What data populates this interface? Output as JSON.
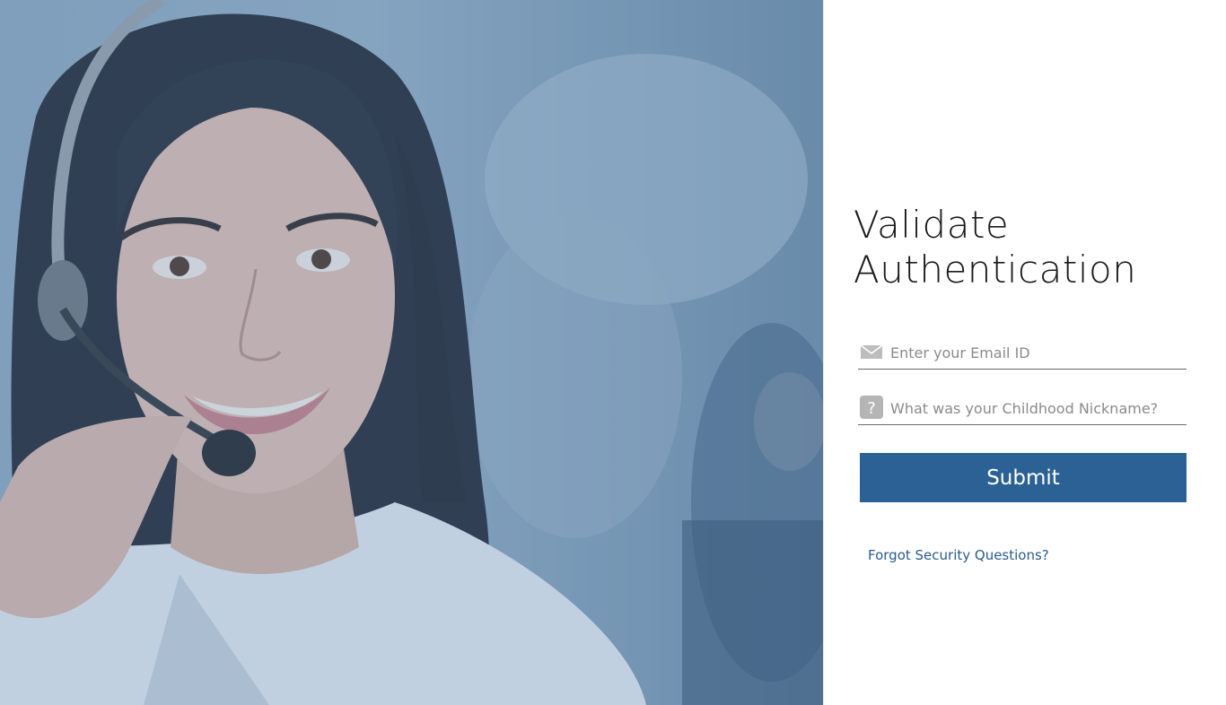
{
  "hero": {
    "icon": "support-agent-photo",
    "overlay_color": "#8aa7c1"
  },
  "form": {
    "title_line1": "Validate",
    "title_line2": "Authentication",
    "email": {
      "icon": "envelope-icon",
      "placeholder": "Enter your Email ID",
      "value": ""
    },
    "nickname": {
      "icon": "question-mark-icon",
      "placeholder": "What was your Childhood Nickname?",
      "value": ""
    },
    "submit_label": "Submit",
    "forgot_link": "Forgot Security Questions?",
    "colors": {
      "button": "#2c6195",
      "link": "#2a5b8c",
      "title": "#1a1a1a"
    }
  }
}
